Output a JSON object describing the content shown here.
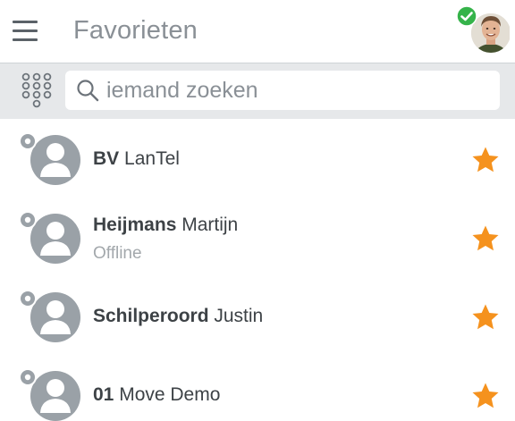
{
  "header": {
    "title": "Favorieten",
    "menu_icon": "hamburger-menu-icon",
    "own_status_color": "#35b34a"
  },
  "search": {
    "placeholder": "iemand zoeken",
    "value": ""
  },
  "colors": {
    "star": "#f5921e",
    "avatar": "#9aa1a7",
    "presence_dot": "#9aa1a7"
  },
  "contacts": [
    {
      "last_name": "BV",
      "first_name": "LanTel",
      "status": "",
      "favorite": true
    },
    {
      "last_name": "Heijmans",
      "first_name": "Martijn",
      "status": "Offline",
      "favorite": true
    },
    {
      "last_name": "Schilperoord",
      "first_name": "Justin",
      "status": "",
      "favorite": true
    },
    {
      "last_name": "01",
      "first_name": "Move Demo",
      "status": "",
      "favorite": true
    }
  ]
}
